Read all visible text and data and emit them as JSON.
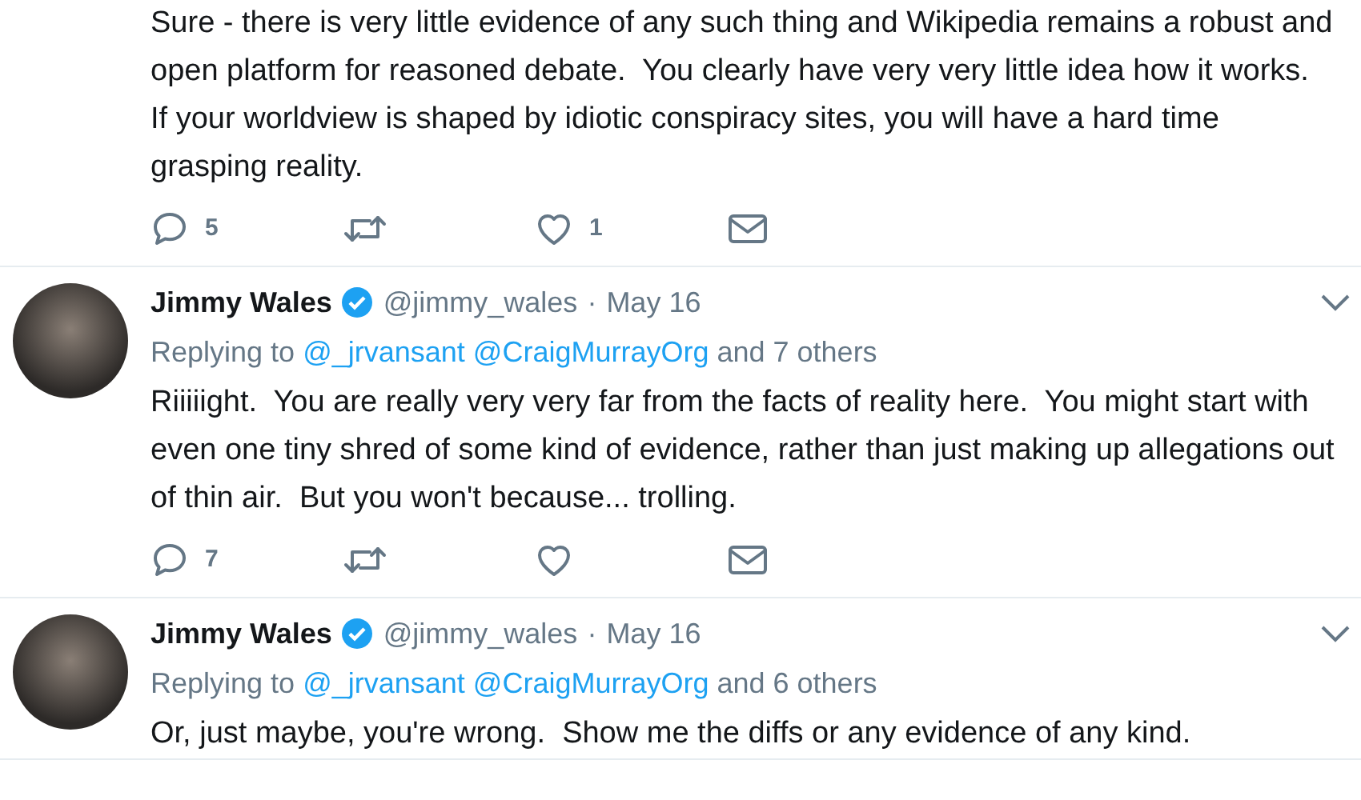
{
  "tweets": [
    {
      "body": "Sure - there is very little evidence of any such thing and Wikipedia remains a robust and open platform for reasoned debate.  You clearly have very very little idea how it works.  If your worldview is shaped by idiotic conspiracy sites, you will have a hard time grasping reality.",
      "actions": {
        "replies": "5",
        "likes": "1"
      }
    },
    {
      "author": {
        "name": "Jimmy Wales",
        "verified": true,
        "handle": "@jimmy_wales",
        "separator": "·",
        "date": "May 16"
      },
      "replying": {
        "prefix": "Replying to",
        "mentions": [
          "@_jrvansant",
          "@CraigMurrayOrg"
        ],
        "others": "and 7 others"
      },
      "body": "Riiiiight.  You are really very very far from the facts of reality here.  You might start with even one tiny shred of some kind of evidence, rather than just making up allegations out of thin air.  But you won't because... trolling.",
      "actions": {
        "replies": "7"
      }
    },
    {
      "author": {
        "name": "Jimmy Wales",
        "verified": true,
        "handle": "@jimmy_wales",
        "separator": "·",
        "date": "May 16"
      },
      "replying": {
        "prefix": "Replying to",
        "mentions": [
          "@_jrvansant",
          "@CraigMurrayOrg"
        ],
        "others": "and 6 others"
      },
      "body": "Or, just maybe, you're wrong.  Show me the diffs or any evidence of any kind."
    }
  ]
}
